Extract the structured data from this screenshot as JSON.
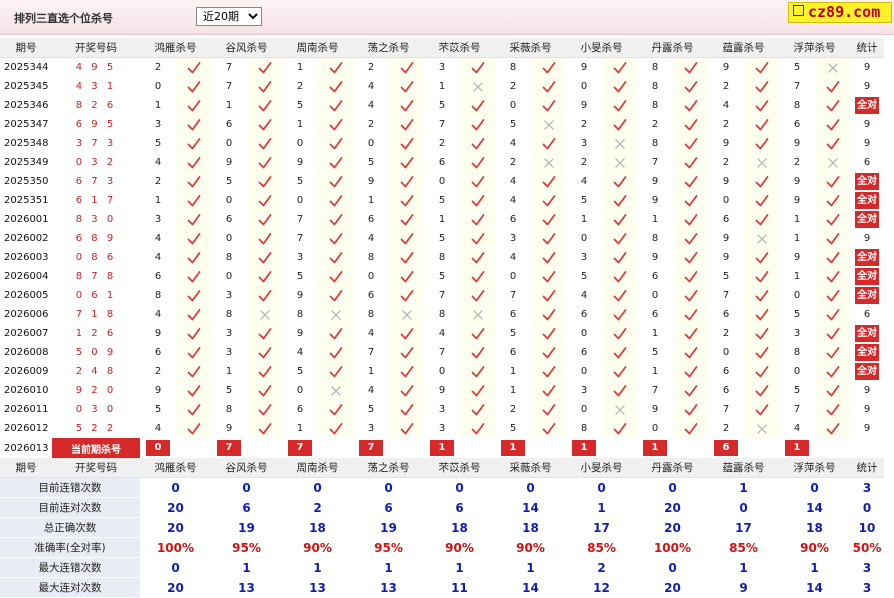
{
  "header": {
    "title": "排列三直选个位杀号",
    "period_select": {
      "selected": "近20期"
    },
    "logo_text": "cz89.com"
  },
  "table": {
    "columns": [
      "期号",
      "开奖号码",
      "鸿雁杀号",
      "谷风杀号",
      "周南杀号",
      "荡之杀号",
      "芣苡杀号",
      "采薇杀号",
      "小旻杀号",
      "丹露杀号",
      "蕴露杀号",
      "浮萍杀号",
      "统计"
    ],
    "full_label": "全对",
    "rows": [
      {
        "issue": "2025344",
        "draw": "4 9 5",
        "picks": [
          2,
          7,
          1,
          2,
          3,
          8,
          9,
          8,
          9,
          5
        ],
        "hits": [
          1,
          1,
          1,
          1,
          1,
          1,
          1,
          1,
          1,
          0
        ],
        "stat": "9"
      },
      {
        "issue": "2025345",
        "draw": "4 3 1",
        "picks": [
          0,
          7,
          2,
          4,
          1,
          2,
          0,
          8,
          2,
          7
        ],
        "hits": [
          1,
          1,
          1,
          1,
          0,
          1,
          1,
          1,
          1,
          1
        ],
        "stat": "9"
      },
      {
        "issue": "2025346",
        "draw": "8 2 6",
        "picks": [
          1,
          1,
          5,
          4,
          5,
          0,
          9,
          8,
          4,
          8
        ],
        "hits": [
          1,
          1,
          1,
          1,
          1,
          1,
          1,
          1,
          1,
          1
        ],
        "stat": "全对"
      },
      {
        "issue": "2025347",
        "draw": "6 9 5",
        "picks": [
          3,
          6,
          1,
          2,
          7,
          5,
          2,
          2,
          2,
          6
        ],
        "hits": [
          1,
          1,
          1,
          1,
          1,
          0,
          1,
          1,
          1,
          1
        ],
        "stat": "9"
      },
      {
        "issue": "2025348",
        "draw": "3 7 3",
        "picks": [
          5,
          0,
          0,
          0,
          2,
          4,
          3,
          8,
          9,
          9
        ],
        "hits": [
          1,
          1,
          1,
          1,
          1,
          1,
          0,
          1,
          1,
          1
        ],
        "stat": "9"
      },
      {
        "issue": "2025349",
        "draw": "0 3 2",
        "picks": [
          4,
          9,
          9,
          5,
          6,
          2,
          2,
          7,
          2,
          2
        ],
        "hits": [
          1,
          1,
          1,
          1,
          1,
          0,
          0,
          1,
          0,
          0
        ],
        "stat": "6"
      },
      {
        "issue": "2025350",
        "draw": "6 7 3",
        "picks": [
          2,
          5,
          5,
          9,
          0,
          4,
          4,
          9,
          9,
          9
        ],
        "hits": [
          1,
          1,
          1,
          1,
          1,
          1,
          1,
          1,
          1,
          1
        ],
        "stat": "全对"
      },
      {
        "issue": "2025351",
        "draw": "6 1 7",
        "picks": [
          1,
          0,
          0,
          1,
          5,
          4,
          5,
          9,
          0,
          9
        ],
        "hits": [
          1,
          1,
          1,
          1,
          1,
          1,
          1,
          1,
          1,
          1
        ],
        "stat": "全对"
      },
      {
        "issue": "2026001",
        "draw": "8 3 0",
        "picks": [
          3,
          6,
          7,
          6,
          1,
          6,
          1,
          1,
          6,
          1
        ],
        "hits": [
          1,
          1,
          1,
          1,
          1,
          1,
          1,
          1,
          1,
          1
        ],
        "stat": "全对"
      },
      {
        "issue": "2026002",
        "draw": "6 8 9",
        "picks": [
          4,
          0,
          7,
          4,
          5,
          3,
          0,
          8,
          9,
          1
        ],
        "hits": [
          1,
          1,
          1,
          1,
          1,
          1,
          1,
          1,
          0,
          1
        ],
        "stat": "9"
      },
      {
        "issue": "2026003",
        "draw": "0 8 6",
        "picks": [
          4,
          8,
          3,
          8,
          8,
          4,
          3,
          9,
          9,
          9
        ],
        "hits": [
          1,
          1,
          1,
          1,
          1,
          1,
          1,
          1,
          1,
          1
        ],
        "stat": "全对"
      },
      {
        "issue": "2026004",
        "draw": "8 7 8",
        "picks": [
          6,
          0,
          5,
          0,
          5,
          0,
          5,
          6,
          5,
          1
        ],
        "hits": [
          1,
          1,
          1,
          1,
          1,
          1,
          1,
          1,
          1,
          1
        ],
        "stat": "全对"
      },
      {
        "issue": "2026005",
        "draw": "0 6 1",
        "picks": [
          8,
          3,
          9,
          6,
          7,
          7,
          4,
          0,
          7,
          0
        ],
        "hits": [
          1,
          1,
          1,
          1,
          1,
          1,
          1,
          1,
          1,
          1
        ],
        "stat": "全对"
      },
      {
        "issue": "2026006",
        "draw": "7 1 8",
        "picks": [
          4,
          8,
          8,
          8,
          8,
          6,
          6,
          6,
          6,
          5
        ],
        "hits": [
          1,
          0,
          0,
          0,
          0,
          1,
          1,
          1,
          1,
          1
        ],
        "stat": "6"
      },
      {
        "issue": "2026007",
        "draw": "1 2 6",
        "picks": [
          9,
          3,
          9,
          4,
          4,
          5,
          0,
          1,
          2,
          3
        ],
        "hits": [
          1,
          1,
          1,
          1,
          1,
          1,
          1,
          1,
          1,
          1
        ],
        "stat": "全对"
      },
      {
        "issue": "2026008",
        "draw": "5 0 9",
        "picks": [
          6,
          3,
          4,
          7,
          7,
          6,
          6,
          5,
          0,
          8
        ],
        "hits": [
          1,
          1,
          1,
          1,
          1,
          1,
          1,
          1,
          1,
          1
        ],
        "stat": "全对"
      },
      {
        "issue": "2026009",
        "draw": "2 4 8",
        "picks": [
          2,
          1,
          5,
          1,
          0,
          1,
          0,
          1,
          6,
          0
        ],
        "hits": [
          1,
          1,
          1,
          1,
          1,
          1,
          1,
          1,
          1,
          1
        ],
        "stat": "全对"
      },
      {
        "issue": "2026010",
        "draw": "9 2 0",
        "picks": [
          9,
          5,
          0,
          4,
          9,
          1,
          3,
          7,
          6,
          5
        ],
        "hits": [
          1,
          1,
          0,
          1,
          1,
          1,
          1,
          1,
          1,
          1
        ],
        "stat": "9"
      },
      {
        "issue": "2026011",
        "draw": "0 3 0",
        "picks": [
          5,
          8,
          6,
          5,
          3,
          2,
          0,
          9,
          7,
          7
        ],
        "hits": [
          1,
          1,
          1,
          1,
          1,
          1,
          0,
          1,
          1,
          1
        ],
        "stat": "9"
      },
      {
        "issue": "2026012",
        "draw": "5 2 2",
        "picks": [
          4,
          9,
          1,
          3,
          3,
          5,
          8,
          0,
          2,
          4
        ],
        "hits": [
          1,
          1,
          1,
          1,
          1,
          1,
          1,
          1,
          0,
          1
        ],
        "stat": "9"
      }
    ],
    "current": {
      "issue": "2026013",
      "label": "当前期杀号",
      "picks": [
        "0",
        "7",
        "7",
        "7",
        "1",
        "1",
        "1",
        "1",
        "6",
        "1"
      ]
    },
    "footer_header": [
      "期号",
      "开奖号码",
      "鸿雁杀号",
      "谷风杀号",
      "周南杀号",
      "荡之杀号",
      "芣苡杀号",
      "采薇杀号",
      "小旻杀号",
      "丹露杀号",
      "蕴露杀号",
      "浮萍杀号",
      "统计"
    ],
    "stats": [
      {
        "label": "目前连错次数",
        "values": [
          "0",
          "0",
          "0",
          "0",
          "0",
          "0",
          "0",
          "0",
          "1",
          "0",
          "3"
        ],
        "color": "blue"
      },
      {
        "label": "目前连对次数",
        "values": [
          "20",
          "6",
          "2",
          "6",
          "6",
          "14",
          "1",
          "20",
          "0",
          "14",
          "0"
        ],
        "color": "blue"
      },
      {
        "label": "总正确次数",
        "values": [
          "20",
          "19",
          "18",
          "19",
          "18",
          "18",
          "17",
          "20",
          "17",
          "18",
          "10"
        ],
        "color": "blue"
      },
      {
        "label": "准确率(全对率)",
        "values": [
          "100%",
          "95%",
          "90%",
          "95%",
          "90%",
          "90%",
          "85%",
          "100%",
          "85%",
          "90%",
          "50%"
        ],
        "color": "red"
      },
      {
        "label": "最大连错次数",
        "values": [
          "0",
          "1",
          "1",
          "1",
          "1",
          "1",
          "2",
          "0",
          "1",
          "1",
          "3"
        ],
        "color": "blue"
      },
      {
        "label": "最大连对次数",
        "values": [
          "20",
          "13",
          "13",
          "13",
          "11",
          "14",
          "12",
          "20",
          "9",
          "14",
          "3"
        ],
        "color": "blue"
      }
    ]
  },
  "colors": {
    "accent_red": "#d62a2a",
    "value_blue": "#0f1eb4",
    "check_red": "#e03a3a",
    "cross_grey": "#b8b8b8"
  },
  "icons": {
    "hit": "check-icon",
    "miss": "cross-icon"
  }
}
